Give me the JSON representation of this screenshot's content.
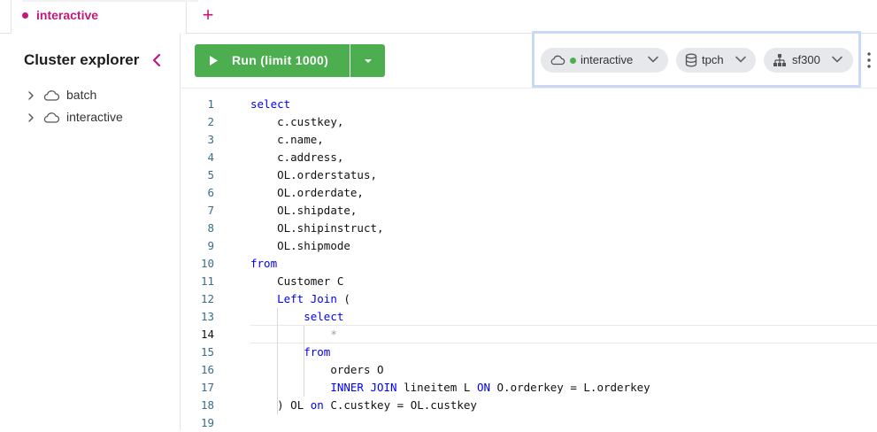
{
  "tabs": [
    {
      "label": "interactive",
      "active": true,
      "dot_color": "#c2187a"
    }
  ],
  "add_tab_label": "+",
  "sidebar": {
    "title": "Cluster explorer",
    "items": [
      {
        "label": "batch",
        "icon": "cloud-icon"
      },
      {
        "label": "interactive",
        "icon": "cloud-icon"
      }
    ]
  },
  "toolbar": {
    "run_label": "Run (limit 1000)",
    "run_color": "#4cae4f"
  },
  "context": {
    "cluster": {
      "label": "interactive",
      "status_color": "#4cae4f",
      "icon": "cloud-icon"
    },
    "catalog": {
      "label": "tpch",
      "icon": "database-icon"
    },
    "schema": {
      "label": "sf300",
      "icon": "schema-tree-icon"
    }
  },
  "editor": {
    "active_line": 14,
    "lines": [
      {
        "n": "1",
        "text": "select"
      },
      {
        "n": "2",
        "text": "    c.custkey,"
      },
      {
        "n": "3",
        "text": "    c.name,"
      },
      {
        "n": "4",
        "text": "    c.address,"
      },
      {
        "n": "5",
        "text": "    OL.orderstatus,"
      },
      {
        "n": "6",
        "text": "    OL.orderdate,"
      },
      {
        "n": "7",
        "text": "    OL.shipdate,"
      },
      {
        "n": "8",
        "text": "    OL.shipinstruct,"
      },
      {
        "n": "9",
        "text": "    OL.shipmode"
      },
      {
        "n": "10",
        "text": "from"
      },
      {
        "n": "11",
        "text": "    Customer C"
      },
      {
        "n": "12",
        "text": "    Left Join ("
      },
      {
        "n": "13",
        "text": "        select"
      },
      {
        "n": "14",
        "text": "            *"
      },
      {
        "n": "15",
        "text": "        from"
      },
      {
        "n": "16",
        "text": "            orders O"
      },
      {
        "n": "17",
        "text": "            INNER JOIN lineitem L ON O.orderkey = L.orderkey"
      },
      {
        "n": "18",
        "text": "    ) OL on C.custkey = OL.custkey"
      },
      {
        "n": "19",
        "text": ""
      }
    ]
  }
}
